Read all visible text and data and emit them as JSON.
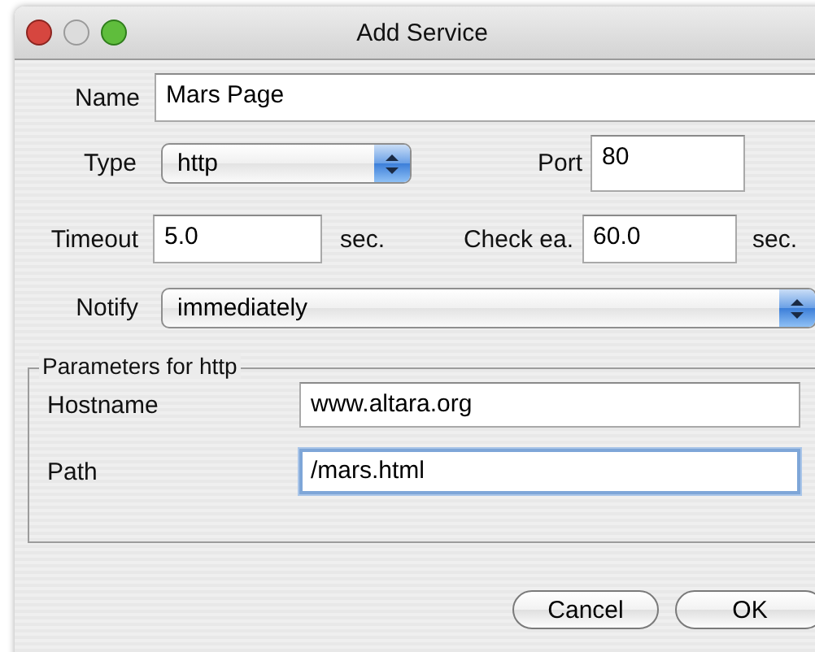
{
  "window": {
    "title": "Add Service"
  },
  "name": {
    "label": "Name",
    "value": "Mars Page"
  },
  "type": {
    "label": "Type",
    "value": "http"
  },
  "port": {
    "label": "Port",
    "value": "80"
  },
  "timeout": {
    "label": "Timeout",
    "value": "5.0",
    "unit": "sec."
  },
  "check": {
    "label": "Check ea.",
    "value": "60.0",
    "unit": "sec."
  },
  "notify": {
    "label": "Notify",
    "value": "immediately"
  },
  "parameters": {
    "title": "Parameters for http",
    "fields": [
      {
        "label": "Hostname",
        "value": "www.altara.org",
        "focused": false
      },
      {
        "label": "Path",
        "value": "/mars.html",
        "focused": true
      }
    ]
  },
  "buttons": [
    "Cancel",
    "OK"
  ]
}
